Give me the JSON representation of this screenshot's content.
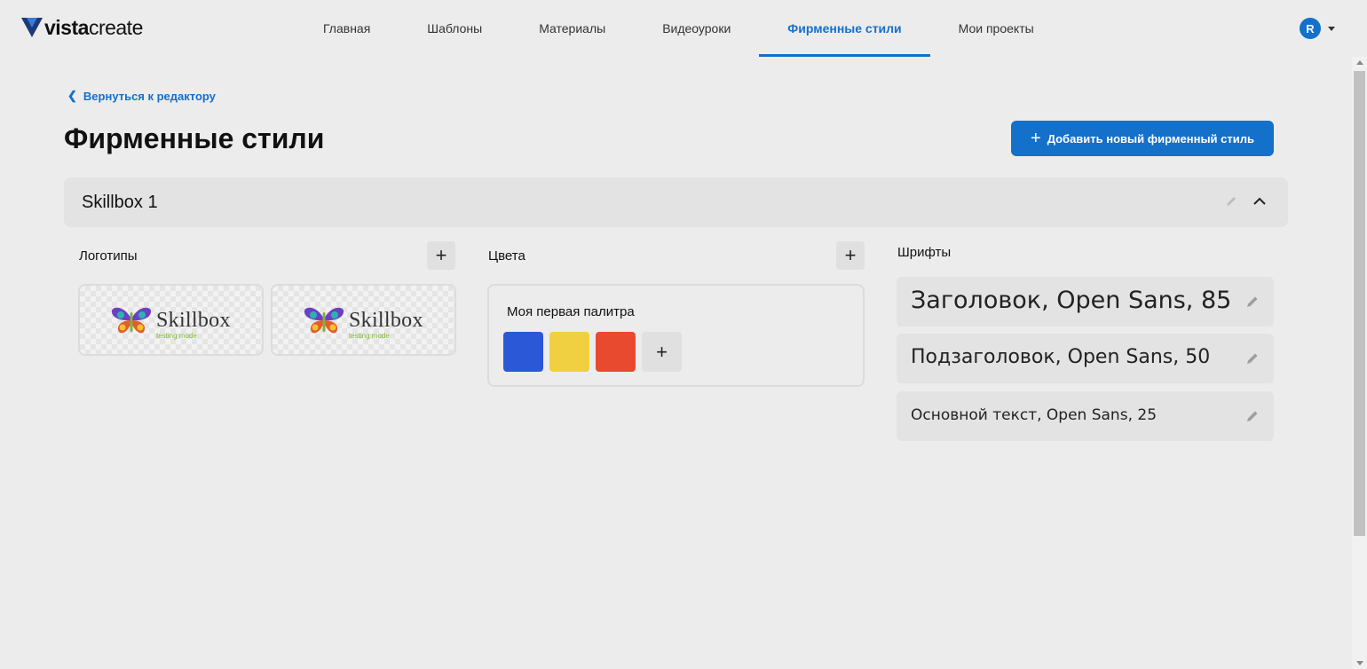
{
  "brand": {
    "logo_bold": "vista",
    "logo_light": "create",
    "logo_tm": "..."
  },
  "nav": {
    "items": [
      {
        "label": "Главная"
      },
      {
        "label": "Шаблоны"
      },
      {
        "label": "Материалы"
      },
      {
        "label": "Видеоуроки"
      },
      {
        "label": "Фирменные стили",
        "active": true
      },
      {
        "label": "Мои проекты"
      }
    ],
    "avatar_initial": "R"
  },
  "back_link": "Вернуться к редактору",
  "page_title": "Фирменные стили",
  "add_style_button": "Добавить новый фирменный стиль",
  "style_kit": {
    "name": "Skillbox 1",
    "logos": {
      "label": "Логотипы",
      "items": [
        {
          "name": "Skillbox",
          "sub": "testing mode"
        },
        {
          "name": "Skillbox",
          "sub": "testing mode"
        }
      ]
    },
    "colors": {
      "label": "Цвета",
      "palette_name": "Моя первая палитра",
      "swatches": [
        "#2b58d6",
        "#f0d040",
        "#e84a30"
      ]
    },
    "fonts": {
      "label": "Шрифты",
      "items": [
        {
          "text": "Заголовок, Open Sans, 85"
        },
        {
          "text": "Подзаголовок, Open Sans, 50"
        },
        {
          "text": "Основной текст, Open Sans, 25"
        }
      ]
    }
  },
  "colors": {
    "accent": "#1470c9",
    "background": "#ececec",
    "panel": "#e3e3e3"
  },
  "icons": {
    "back": "chevron-left-icon",
    "collapse": "chevron-up-icon",
    "edit": "pencil-icon",
    "add": "plus-icon",
    "menu": "caret-down-icon"
  }
}
